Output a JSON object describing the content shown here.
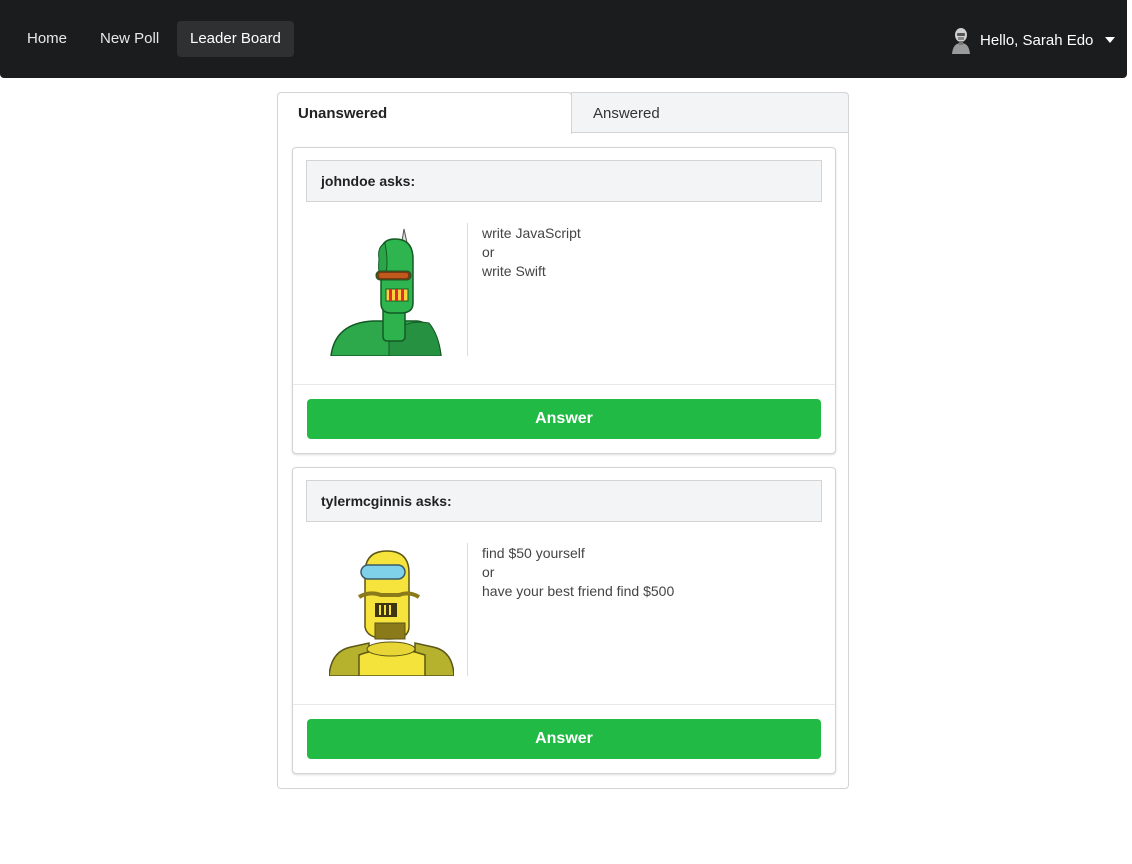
{
  "nav": {
    "home": "Home",
    "new_poll": "New Poll",
    "leader_board": "Leader Board",
    "user_greeting": "Hello, Sarah Edo"
  },
  "tabs": {
    "unanswered": "Unanswered",
    "answered": "Answered",
    "active": "Unanswered"
  },
  "questions": [
    {
      "asker": "johndoe asks:",
      "avatar": "green-robot-icon",
      "option_one": "write JavaScript",
      "separator": "or",
      "option_two": "write Swift",
      "button_label": "Answer"
    },
    {
      "asker": "tylermcginnis asks:",
      "avatar": "yellow-robot-icon",
      "option_one": "find $50 yourself",
      "separator": "or",
      "option_two": "have your best friend find $500",
      "button_label": "Answer"
    }
  ],
  "colors": {
    "navbar": "#1b1c1d",
    "answer_button": "#21ba45",
    "card_header": "#f3f4f5"
  }
}
